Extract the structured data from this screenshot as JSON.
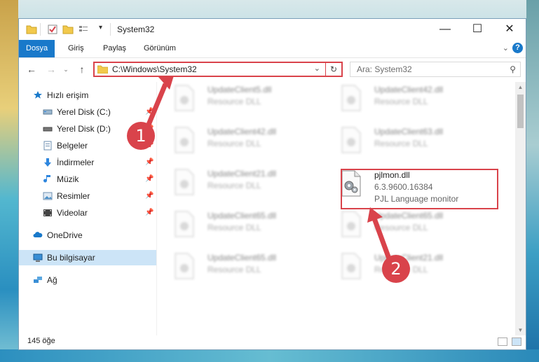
{
  "window": {
    "title": "System32",
    "controls": {
      "minimize": "—",
      "maximize": "☐",
      "close": "✕"
    }
  },
  "ribbon": {
    "tabs": [
      {
        "label": "Dosya",
        "active": true
      },
      {
        "label": "Giriş"
      },
      {
        "label": "Paylaş"
      },
      {
        "label": "Görünüm"
      }
    ],
    "help": "?"
  },
  "nav": {
    "address": "C:\\Windows\\System32",
    "search_placeholder": "Ara: System32"
  },
  "sidebar": {
    "items": [
      {
        "label": "Hızlı erişim",
        "icon": "star-icon"
      },
      {
        "label": "Yerel Disk (C:)",
        "icon": "drive-icon"
      },
      {
        "label": "Yerel Disk (D:)",
        "icon": "drive-icon"
      },
      {
        "label": "Belgeler",
        "icon": "documents-icon"
      },
      {
        "label": "İndirmeler",
        "icon": "download-icon"
      },
      {
        "label": "Müzik",
        "icon": "music-icon"
      },
      {
        "label": "Resimler",
        "icon": "pictures-icon"
      },
      {
        "label": "Videolar",
        "icon": "video-icon"
      },
      {
        "label": "OneDrive",
        "icon": "cloud-icon"
      },
      {
        "label": "Bu bilgisayar",
        "icon": "computer-icon"
      },
      {
        "label": "Ağ",
        "icon": "network-icon"
      }
    ]
  },
  "files": {
    "left": [
      {
        "name": "UpdateClient5.dll",
        "desc": "Resource DLL"
      },
      {
        "name": "UpdateClient42.dll",
        "desc": "Resource DLL"
      },
      {
        "name": "UpdateClient21.dll",
        "desc": "Resource DLL"
      },
      {
        "name": "UpdateClient65.dll",
        "desc": "Resource DLL"
      },
      {
        "name": "UpdateClient65.dll",
        "desc": "Resource DLL"
      }
    ],
    "right": [
      {
        "name": "UpdateClient42.dll",
        "desc": "Resource DLL"
      },
      {
        "name": "UpdateClient63.dll",
        "desc": "Resource DLL"
      },
      {
        "name": "UpdateClient65.dll",
        "desc": "Resource DLL"
      },
      {
        "name": "UpdateClient21.dll",
        "desc": "Resource DLL"
      }
    ],
    "highlighted": {
      "name": "pjlmon.dll",
      "version": "6.3.9600.16384",
      "desc": "PJL Language monitor"
    }
  },
  "status": {
    "item_count": "145 öğe"
  },
  "annotations": {
    "step1": "1",
    "step2": "2"
  },
  "colors": {
    "accent": "#1979ca",
    "highlight": "#d9434b",
    "selected": "#cce4f7"
  }
}
